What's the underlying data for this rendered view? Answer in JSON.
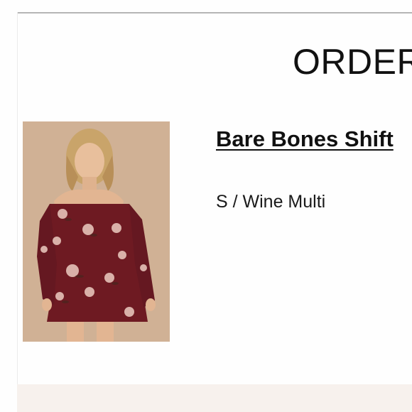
{
  "order": {
    "heading": "ORDER"
  },
  "product": {
    "name": "Bare Bones Shift",
    "variant": "S / Wine Multi",
    "image_icon": "product-photo"
  },
  "colors": {
    "background": "#fefefe",
    "text": "#111111",
    "rule": "#b5b5b5",
    "footer_band": "#f7f1ed",
    "photo_backdrop": "#d3b598",
    "dress": "#6e1a22"
  }
}
